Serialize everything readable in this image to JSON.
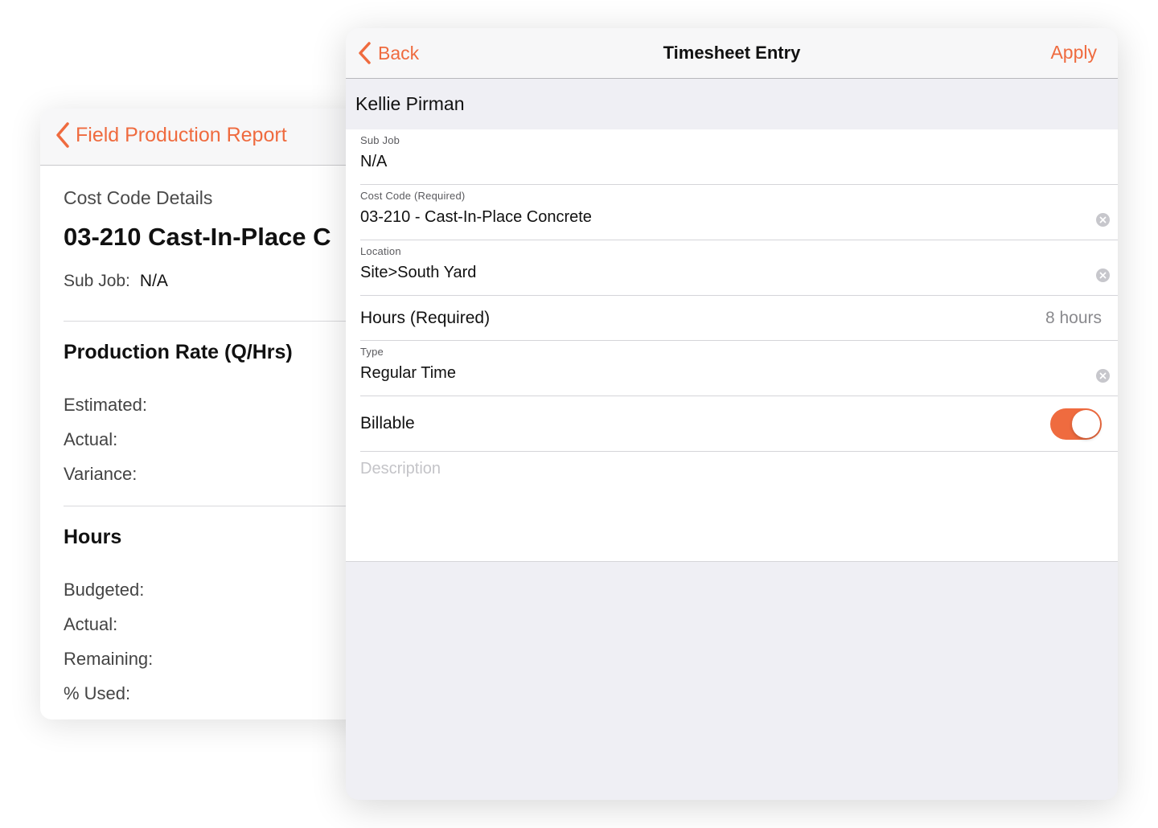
{
  "report_card": {
    "back_label": "Field Production Report",
    "section_label": "Cost Code Details",
    "title": "03-210 Cast-In-Place C",
    "sub_job_label": "Sub Job:",
    "sub_job_value": "N/A",
    "production_heading": "Production Rate (Q/Hrs)",
    "production_rows": [
      "Estimated:",
      "Actual:",
      "Variance:"
    ],
    "hours_heading": "Hours",
    "hours_rows": [
      "Budgeted:",
      "Actual:",
      "Remaining:",
      "% Used:"
    ]
  },
  "timesheet": {
    "back_label": "Back",
    "title": "Timesheet Entry",
    "apply_label": "Apply",
    "employee": "Kellie Pirman",
    "sub_job": {
      "label": "Sub Job",
      "value": "N/A"
    },
    "cost_code": {
      "label": "Cost Code (Required)",
      "value": "03-210 - Cast-In-Place Concrete"
    },
    "location": {
      "label": "Location",
      "value": "Site>South Yard"
    },
    "hours": {
      "label": "Hours (Required)",
      "value": "8 hours"
    },
    "type": {
      "label": "Type",
      "value": "Regular Time"
    },
    "billable": {
      "label": "Billable",
      "on": true
    },
    "description_placeholder": "Description"
  },
  "colors": {
    "accent": "#ef6b3f",
    "toggle_on": "#ef6b3f"
  },
  "icons": [
    "chevron-left-icon",
    "clear-icon"
  ]
}
